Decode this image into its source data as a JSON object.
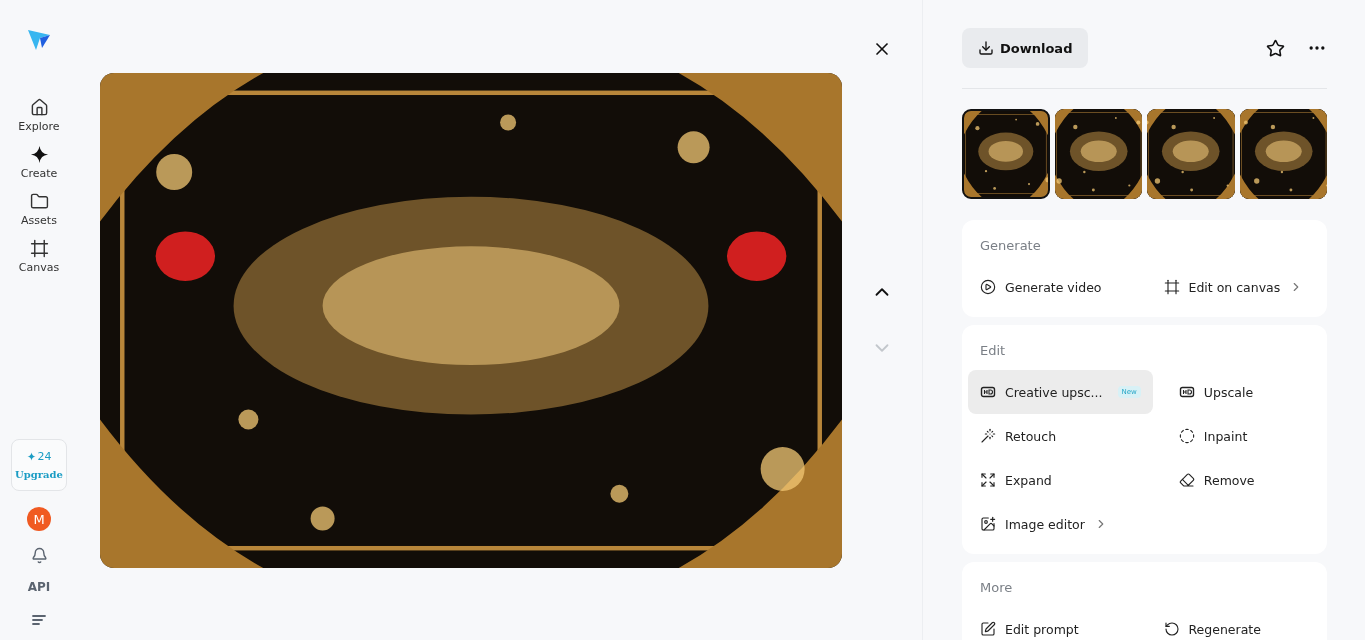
{
  "sidebar": {
    "nav": [
      {
        "label": "Explore"
      },
      {
        "label": "Create"
      },
      {
        "label": "Assets"
      },
      {
        "label": "Canvas"
      }
    ],
    "credits": {
      "count": "24",
      "action": "Upgrade"
    },
    "avatar": "M",
    "api": "API"
  },
  "viewer": {
    "kind": "picture",
    "next_disabled": true
  },
  "toolbar": {
    "download": "Download"
  },
  "thumbnails": [
    {
      "selected": true
    },
    {
      "selected": false
    },
    {
      "selected": false
    },
    {
      "selected": false
    }
  ],
  "sections": [
    {
      "title": "Generate",
      "items": [
        {
          "label": "Generate video",
          "submenu": false,
          "selected": false
        },
        {
          "label": "Edit on canvas",
          "submenu": true,
          "selected": false
        }
      ]
    },
    {
      "title": "Edit",
      "items": [
        {
          "label": "Creative upsc...",
          "badge": "New",
          "submenu": false,
          "selected": true
        },
        {
          "label": "Upscale",
          "submenu": false,
          "selected": false
        },
        {
          "label": "Retouch",
          "submenu": false,
          "selected": false
        },
        {
          "label": "Inpaint",
          "submenu": false,
          "selected": false
        },
        {
          "label": "Expand",
          "submenu": false,
          "selected": false
        },
        {
          "label": "Remove",
          "submenu": false,
          "selected": false
        },
        {
          "label": "Image editor",
          "submenu": true,
          "selected": false
        }
      ]
    },
    {
      "title": "More",
      "items": [
        {
          "label": "Edit prompt",
          "submenu": false,
          "selected": false
        },
        {
          "label": "Regenerate",
          "submenu": false,
          "selected": false
        }
      ]
    }
  ]
}
